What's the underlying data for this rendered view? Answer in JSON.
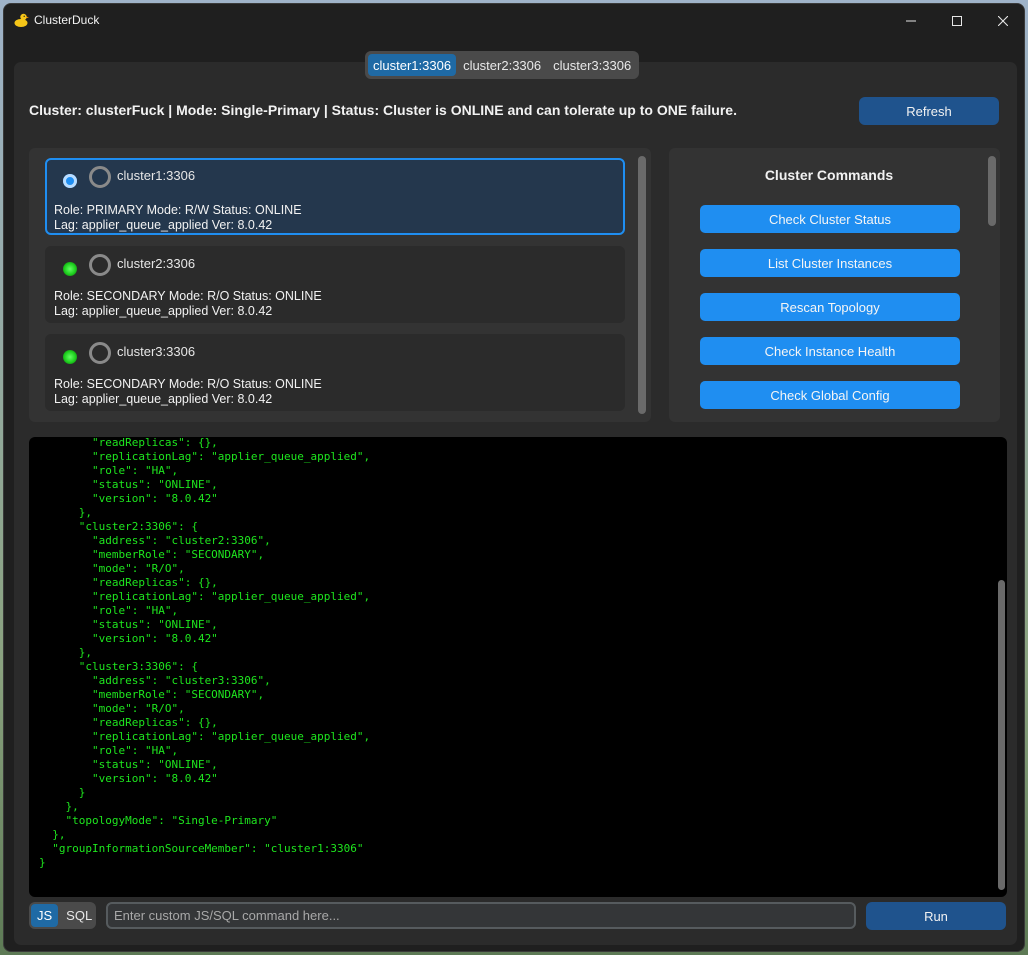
{
  "window": {
    "title": "ClusterDuck"
  },
  "tabs": [
    {
      "label": "cluster1:3306",
      "active": true
    },
    {
      "label": "cluster2:3306",
      "active": false
    },
    {
      "label": "cluster3:3306",
      "active": false
    }
  ],
  "header": {
    "info": "Cluster: clusterFuck  |  Mode: Single-Primary  |  Status: Cluster is ONLINE and can tolerate up to ONE failure.",
    "refresh_label": "Refresh"
  },
  "instances": [
    {
      "name": "cluster1:3306",
      "line1": "Role: PRIMARY  Mode: R/W  Status: ONLINE",
      "line2": "Lag: applier_queue_applied  Ver: 8.0.42",
      "selected": true,
      "indicator": "#1f8ef1"
    },
    {
      "name": "cluster2:3306",
      "line1": "Role: SECONDARY  Mode: R/O  Status: ONLINE",
      "line2": "Lag: applier_queue_applied  Ver: 8.0.42",
      "selected": false,
      "indicator": "#1ecf1e"
    },
    {
      "name": "cluster3:3306",
      "line1": "Role: SECONDARY  Mode: R/O  Status: ONLINE",
      "line2": "Lag: applier_queue_applied  Ver: 8.0.42",
      "selected": false,
      "indicator": "#1ecf1e"
    }
  ],
  "commands": {
    "title": "Cluster Commands",
    "buttons": [
      "Check Cluster Status",
      "List Cluster Instances",
      "Rescan Topology",
      "Check Instance Health",
      "Check Global Config"
    ]
  },
  "console": {
    "text": "        \"readReplicas\": {},\n        \"replicationLag\": \"applier_queue_applied\",\n        \"role\": \"HA\",\n        \"status\": \"ONLINE\",\n        \"version\": \"8.0.42\"\n      },\n      \"cluster2:3306\": {\n        \"address\": \"cluster2:3306\",\n        \"memberRole\": \"SECONDARY\",\n        \"mode\": \"R/O\",\n        \"readReplicas\": {},\n        \"replicationLag\": \"applier_queue_applied\",\n        \"role\": \"HA\",\n        \"status\": \"ONLINE\",\n        \"version\": \"8.0.42\"\n      },\n      \"cluster3:3306\": {\n        \"address\": \"cluster3:3306\",\n        \"memberRole\": \"SECONDARY\",\n        \"mode\": \"R/O\",\n        \"readReplicas\": {},\n        \"replicationLag\": \"applier_queue_applied\",\n        \"role\": \"HA\",\n        \"status\": \"ONLINE\",\n        \"version\": \"8.0.42\"\n      }\n    },\n    \"topologyMode\": \"Single-Primary\"\n  },\n  \"groupInformationSourceMember\": \"cluster1:3306\"\n}"
  },
  "footer": {
    "modes": [
      {
        "label": "JS",
        "active": true
      },
      {
        "label": "SQL",
        "active": false
      }
    ],
    "input_placeholder": "Enter custom JS/SQL command here...",
    "input_value": "",
    "run_label": "Run"
  },
  "colors": {
    "accent": "#1f8ef1",
    "dark_button": "#1f538d",
    "console_text": "#1ee61e",
    "online": "#1ecf1e"
  }
}
